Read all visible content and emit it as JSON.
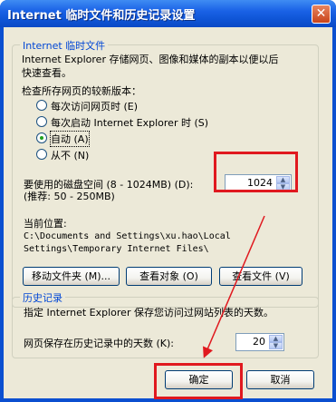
{
  "window": {
    "title": "Internet 临时文件和历史记录设置",
    "close_glyph": "✕"
  },
  "temp_files": {
    "group_title": "Internet 临时文件",
    "description_line1": "Internet Explorer 存储网页、图像和媒体的副本以便以后",
    "description_line2": "快速查看。",
    "check_label": "检查所存网页的较新版本：",
    "options": [
      {
        "label": "每次访问网页时 (E)",
        "checked": false
      },
      {
        "label": "每次启动 Internet Explorer 时 (S)",
        "checked": false
      },
      {
        "label": "自动 (A)",
        "checked": true
      },
      {
        "label": "从不 (N)",
        "checked": false
      }
    ],
    "disk_label_line1": "要使用的磁盘空间 (8 - 1024MB) (D):",
    "disk_label_line2": "(推荐: 50 - 250MB)",
    "disk_value": "1024",
    "location_label": "当前位置:",
    "location_line1": "C:\\Documents and Settings\\xu.hao\\Local",
    "location_line2": "Settings\\Temporary Internet Files\\",
    "move_button": "移动文件夹 (M)...",
    "view_objects_button": "查看对象 (O)",
    "view_files_button": "查看文件 (V)"
  },
  "history": {
    "group_title": "历史记录",
    "description": "指定 Internet Explorer 保存您访问过网站列表的天数。",
    "days_label": "网页保存在历史记录中的天数 (K):",
    "days_value": "20"
  },
  "footer": {
    "ok_button": "确定",
    "cancel_button": "取消"
  },
  "annotation_color": "#e0191f"
}
